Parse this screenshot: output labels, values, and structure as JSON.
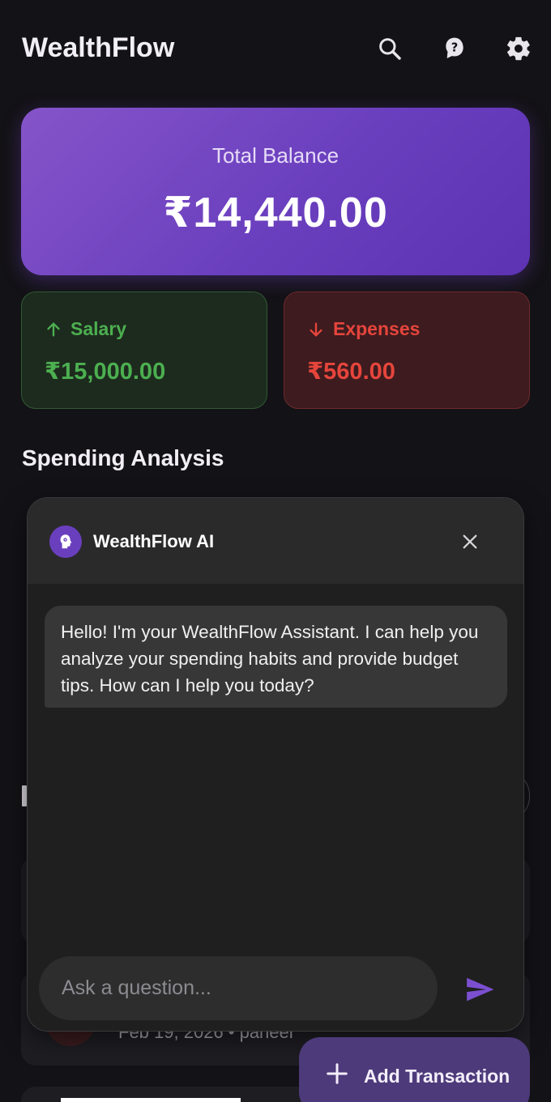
{
  "app": {
    "title": "WealthFlow"
  },
  "appbar": {
    "icons": [
      "search-icon",
      "help-icon",
      "settings-icon"
    ]
  },
  "balance": {
    "label": "Total Balance",
    "amount": "₹14,440.00"
  },
  "salary": {
    "label": "Salary",
    "amount": "₹15,000.00",
    "color": "#4caf50"
  },
  "expenses": {
    "label": "Expenses",
    "amount": "₹560.00",
    "color": "#e5453c"
  },
  "spending": {
    "title": "Spending Analysis"
  },
  "background_list": {
    "visible_subtitle": "Feb 19, 2026 • paneer"
  },
  "chat": {
    "title": "WealthFlow AI",
    "messages": [
      {
        "role": "assistant",
        "text": "Hello! I'm your WealthFlow Assistant. I can help you analyze your spending habits and provide budget tips. How can I help you today?"
      }
    ],
    "input_placeholder": "Ask a question..."
  },
  "fab": {
    "label": "Add Transaction"
  },
  "colors": {
    "accent": "#6a3fbe",
    "background": "#131216"
  }
}
